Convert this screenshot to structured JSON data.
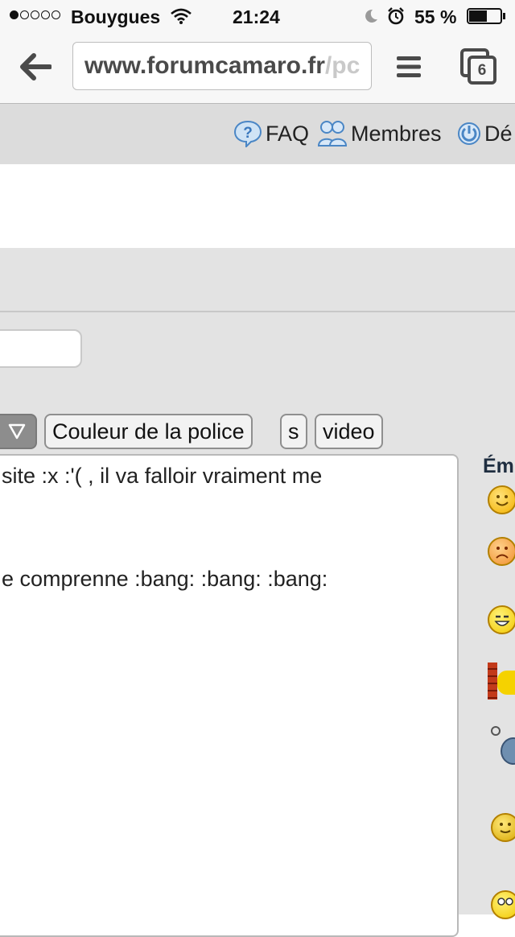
{
  "status_bar": {
    "carrier": "Bouygues",
    "time": "21:24",
    "battery": "55 %"
  },
  "browser": {
    "url_host": "www.forumcamaro.fr",
    "url_rest": "/pc",
    "tab_count": "6"
  },
  "nav": {
    "faq": "FAQ",
    "members": "Membres",
    "logout": "Dé"
  },
  "toolbar": {
    "font_color": "Couleur de la police",
    "s": "s",
    "video": "video"
  },
  "editor": {
    "line1": "site :x   :'( , il va falloir vraiment me",
    "line2": "e comprenne  :bang:  :bang:  :bang:"
  },
  "emoticons": {
    "title": "Ém"
  }
}
